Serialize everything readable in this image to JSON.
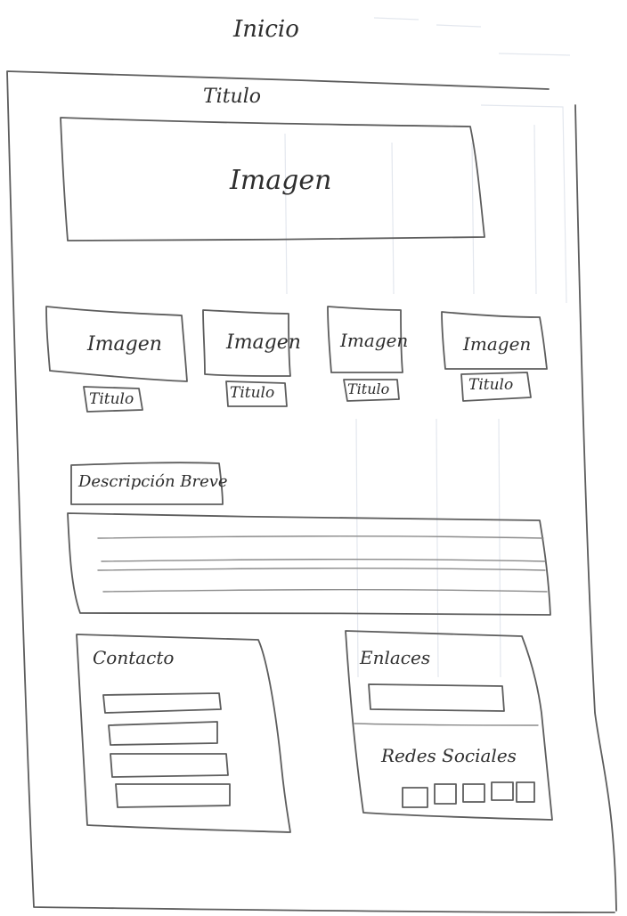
{
  "page": {
    "title": "Inicio"
  },
  "header": {
    "title": "Titulo"
  },
  "hero": {
    "label": "Imagen"
  },
  "gallery": {
    "items": [
      {
        "image_label": "Imagen",
        "title": "Titulo"
      },
      {
        "image_label": "Imagen",
        "title": "Titulo"
      },
      {
        "image_label": "Imagen",
        "title": "Titulo"
      },
      {
        "image_label": "Imagen",
        "title": "Titulo"
      }
    ]
  },
  "description": {
    "label": "Descripción Breve"
  },
  "contact": {
    "label": "Contacto"
  },
  "links": {
    "label": "Enlaces"
  },
  "social": {
    "label": "Redes Sociales",
    "icon_count": 5
  }
}
